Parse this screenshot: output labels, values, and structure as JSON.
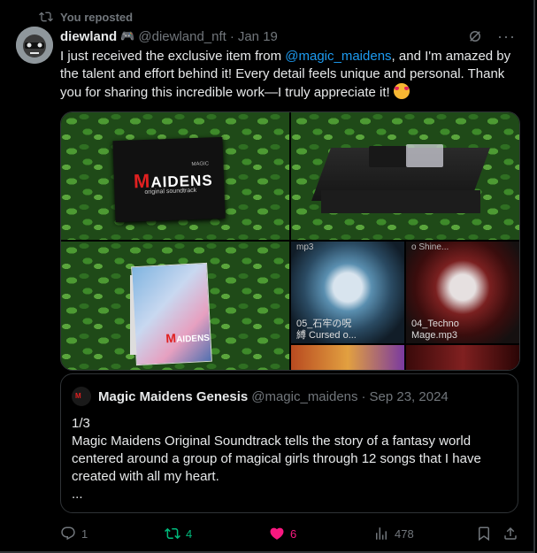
{
  "repost": {
    "label": "You reposted"
  },
  "author": {
    "name": "diewland",
    "badge": "🎮",
    "handle": "@diewland_nft",
    "dot": "·",
    "date": "Jan 19"
  },
  "tweet": {
    "text_before": "I just received the exclusive item from ",
    "mention": "@magic_maidens",
    "text_after": ", and I'm amazed by the talent and effort behind it! Every detail feels unique and personal. Thank you for sharing this incredible work—I truly appreciate it! "
  },
  "media": {
    "photo1": {
      "logo_prefix": "M",
      "logo_rest": "AIDENS",
      "magic": "MAGIC",
      "sub": "original soundtrack"
    },
    "photo3": {
      "logo_prefix": "M",
      "logo_rest": "AIDENS"
    },
    "art": {
      "top_left": "mp3",
      "top_right": "o Shine...",
      "label1": "05_石牢の呪",
      "label1b": "縛 Cursed o...",
      "label2": "04_Techno",
      "label2b": "Mage.mp3"
    }
  },
  "quote": {
    "name": "Magic Maidens Genesis",
    "handle": "@magic_maidens",
    "dot": "·",
    "date": "Sep 23, 2024",
    "avatar_text": "M",
    "lines": [
      "1/3",
      "Magic Maidens Original Soundtrack tells the story of a fantasy world centered around a group of magical girls through 12 songs that I have created with all my heart.",
      "..."
    ]
  },
  "actions": {
    "replies": "1",
    "reposts": "4",
    "likes": "6",
    "views": "478"
  },
  "colors": {
    "accent": "#1d9bf0",
    "repost": "#00ba7c",
    "like": "#f91880",
    "muted": "#71767b"
  }
}
